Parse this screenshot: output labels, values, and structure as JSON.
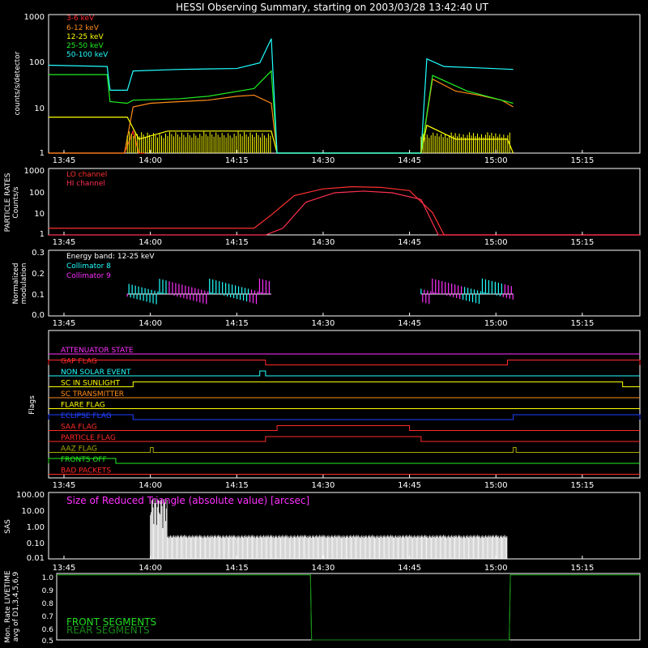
{
  "title": "HESSI Observing Summary, starting on 2003/03/28 13:42:40 UT",
  "colors": {
    "background": "#000000",
    "axis": "#ffffff",
    "e3_6": "#ff2a2a",
    "e6_12": "#ff8c1a",
    "e12_25": "#ffff00",
    "e25_50": "#22ee22",
    "e50_100": "#22ffff",
    "lo": "#ff3030",
    "hi": "#ff3050",
    "coll8": "#22ffff",
    "coll9": "#ff30ff",
    "front": "#22dd22",
    "rear": "#1a8a1a"
  },
  "time_ticks": [
    "13:45",
    "14:00",
    "14:15",
    "14:30",
    "14:45",
    "15:00",
    "15:15"
  ],
  "panels": {
    "counts": {
      "ylabel": "counts/s/detector",
      "yticks": [
        "1000",
        "100",
        "10",
        "1"
      ]
    },
    "particles": {
      "ylabel1": "PARTICLE RATES",
      "ylabel2": "Counts/s",
      "yticks": [
        "1000",
        "100",
        "10",
        "1"
      ]
    },
    "modulation": {
      "ylabel1": "Normalized",
      "ylabel2": "modulation",
      "yticks": [
        "0.3",
        "0.2",
        "0.1",
        "0.0"
      ],
      "band_label": "Energy band: 12-25 keV"
    },
    "flags": {
      "ylabel": "Flags"
    },
    "sas": {
      "ylabel": "SAS",
      "yticks": [
        "100.00",
        "10.00",
        "1.00",
        "0.10",
        "0.01"
      ],
      "label": "Size of Reduced Triangle (absolute value) [arcsec]"
    },
    "livetime": {
      "ylabel1": "Mon. Rate LIVETIME",
      "ylabel2": "avg of D1,3,4,5,6,9",
      "yticks": [
        "1.0",
        "0.9",
        "0.8",
        "0.7",
        "0.6",
        "0.5"
      ]
    }
  },
  "chart_data": [
    {
      "type": "line",
      "title": "HESSI Observing Summary, starting on 2003/03/28 13:42:40 UT",
      "ylabel": "counts/s/detector",
      "yscale": "log",
      "ylim": [
        1,
        1000
      ],
      "x_units": "UT minutes after 13:45",
      "xlim": [
        -2.67,
        100
      ],
      "series": [
        {
          "name": "3-6 keV",
          "x": [
            -2.67,
            10.5,
            12.0,
            13.0,
            14.0
          ],
          "y": [
            1,
            1,
            3,
            1,
            1
          ]
        },
        {
          "name": "6-12 keV",
          "x": [
            -2.67,
            10.5,
            12,
            15,
            20,
            25,
            30,
            33,
            36,
            37,
            62,
            64,
            68,
            72,
            76,
            78
          ],
          "y": [
            1,
            1,
            10,
            12,
            13,
            14,
            17,
            18,
            12,
            1,
            1,
            40,
            22,
            18,
            14,
            10
          ]
        },
        {
          "name": "12-25 keV",
          "x": [
            -2.67,
            11,
            13,
            18,
            25,
            36,
            37,
            62,
            63,
            68,
            77,
            78
          ],
          "y": [
            6,
            6,
            2,
            3,
            3,
            3,
            1,
            1,
            4,
            2,
            2,
            1
          ]
        },
        {
          "name": "25-50 keV",
          "x": [
            -2.67,
            7.5,
            8,
            11,
            12,
            20,
            25,
            33,
            36,
            37,
            62,
            64,
            70,
            78
          ],
          "y": [
            50,
            50,
            13,
            12,
            14,
            15,
            17,
            25,
            60,
            1,
            1,
            48,
            22,
            12
          ]
        },
        {
          "name": "50-100 keV",
          "x": [
            -2.67,
            7.5,
            8,
            11,
            12,
            20,
            30,
            34,
            36,
            37,
            62,
            63,
            66,
            72,
            78
          ],
          "y": [
            80,
            75,
            23,
            23,
            60,
            65,
            68,
            90,
            300,
            1,
            1,
            110,
            75,
            70,
            65
          ]
        }
      ]
    },
    {
      "type": "line",
      "ylabel": "PARTICLE RATES Counts/s",
      "yscale": "log",
      "ylim": [
        1,
        1000
      ],
      "series": [
        {
          "name": "LO channel",
          "x": [
            -2.67,
            33,
            36,
            40,
            45,
            50,
            55,
            60,
            64,
            66,
            100
          ],
          "y": [
            2,
            2,
            8,
            60,
            120,
            150,
            140,
            100,
            10,
            1,
            1
          ]
        },
        {
          "name": "HI channel",
          "x": [
            -2.67,
            35,
            38,
            42,
            47,
            52,
            57,
            62,
            65,
            100
          ],
          "y": [
            1,
            1,
            2,
            30,
            80,
            95,
            80,
            40,
            1,
            1
          ]
        }
      ]
    },
    {
      "type": "line",
      "ylabel": "Normalized modulation",
      "ylim": [
        0,
        0.3
      ],
      "annotation": "Energy band: 12-25 keV",
      "series": [
        {
          "name": "Collimator 8",
          "x": [
            11,
            20,
            36,
            62,
            70,
            78
          ],
          "y": [
            0.1,
            0.11,
            0.1,
            0.1,
            0.12,
            0.1
          ]
        },
        {
          "name": "Collimator 9",
          "x": [
            11,
            20,
            36,
            62,
            70,
            78
          ],
          "y": [
            0.1,
            0.1,
            0.1,
            0.1,
            0.13,
            0.1
          ]
        }
      ]
    },
    {
      "type": "table",
      "ylabel": "Flags",
      "flags": [
        {
          "name": "ATTENUATOR STATE",
          "color": "#ff30ff",
          "high": []
        },
        {
          "name": "GAP FLAG",
          "color": "#ff2a2a",
          "high": [
            [
              -2.67,
              35
            ],
            [
              77,
              100
            ]
          ]
        },
        {
          "name": "NON SOLAR EVENT",
          "color": "#22ffff",
          "high": [
            [
              34,
              35
            ]
          ]
        },
        {
          "name": "SC IN SUNLIGHT",
          "color": "#ffff00",
          "high": [
            [
              12,
              97
            ]
          ]
        },
        {
          "name": "SC TRANSMITTER",
          "color": "#ff8c1a",
          "high": []
        },
        {
          "name": "FLARE FLAG",
          "color": "#ffff00",
          "high": []
        },
        {
          "name": "ECLIPSE FLAG",
          "color": "#2040ff",
          "high": [
            [
              -2.67,
              12
            ],
            [
              78,
              100
            ]
          ]
        },
        {
          "name": "SAA FLAG",
          "color": "#ff2a2a",
          "high": [
            [
              37,
              60
            ]
          ]
        },
        {
          "name": "PARTICLE FLAG",
          "color": "#ff2a2a",
          "high": [
            [
              35,
              62
            ]
          ]
        },
        {
          "name": "AAZ FLAG",
          "color": "#aaaa00",
          "high": [
            [
              15,
              15.5
            ],
            [
              78,
              78.5
            ]
          ]
        },
        {
          "name": "FRONTS OFF",
          "color": "#22ee22",
          "high": [
            [
              -2.67,
              9
            ]
          ]
        },
        {
          "name": "BAD PACKETS",
          "color": "#ff2a2a",
          "high": []
        }
      ]
    },
    {
      "type": "line",
      "ylabel": "SAS",
      "yscale": "log",
      "ylim": [
        0.01,
        100
      ],
      "annotation": "Size of Reduced Triangle (absolute value) [arcsec]",
      "series": [
        {
          "name": "",
          "x": [
            15,
            16,
            18,
            20,
            40,
            77
          ],
          "y": [
            40,
            1,
            0.03,
            0.2,
            0.2,
            0.2
          ]
        }
      ]
    },
    {
      "type": "line",
      "ylabel": "Mon. Rate LIVETIME avg of D1,3,4,5,6,9",
      "ylim": [
        0.5,
        1.0
      ],
      "series": [
        {
          "name": "FRONT SEGMENTS",
          "x": [
            -2.67,
            42,
            42.2,
            77,
            77.2,
            100
          ],
          "y": [
            0.99,
            0.99,
            0.5,
            0.5,
            0.99,
            0.99
          ]
        },
        {
          "name": "REAR SEGMENTS",
          "x": [
            -2.67,
            42,
            42.2,
            77,
            77.2,
            100
          ],
          "y": [
            0.99,
            0.99,
            0.5,
            0.5,
            0.99,
            0.99
          ]
        }
      ]
    }
  ]
}
